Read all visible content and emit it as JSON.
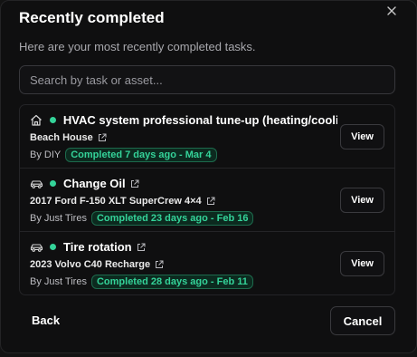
{
  "dialog": {
    "title": "Recently completed",
    "subtitle": "Here are your most recently completed tasks.",
    "close_icon": "close-icon"
  },
  "search": {
    "placeholder": "Search by task or asset...",
    "value": ""
  },
  "tasks": [
    {
      "category_icon": "home-icon",
      "title": "HVAC system professional tune-up (heating/cooli",
      "asset": "Beach House",
      "by": "By DIY",
      "status": "Completed 7 days ago - Mar 4",
      "action": "View"
    },
    {
      "category_icon": "car-icon",
      "title": "Change Oil",
      "asset": "2017 Ford F-150 XLT SuperCrew 4×4",
      "by": "By Just Tires",
      "status": "Completed 23 days ago - Feb 16",
      "action": "View"
    },
    {
      "category_icon": "car-icon",
      "title": "Tire rotation",
      "asset": "2023 Volvo C40 Recharge",
      "by": "By Just Tires",
      "status": "Completed 28 days ago - Feb 11",
      "action": "View"
    }
  ],
  "footer": {
    "back_label": "Back",
    "cancel_label": "Cancel"
  },
  "colors": {
    "background": "#0f0f10",
    "accent_green": "#34d399",
    "badge_bg": "#0c2a1f",
    "border": "#242427"
  }
}
